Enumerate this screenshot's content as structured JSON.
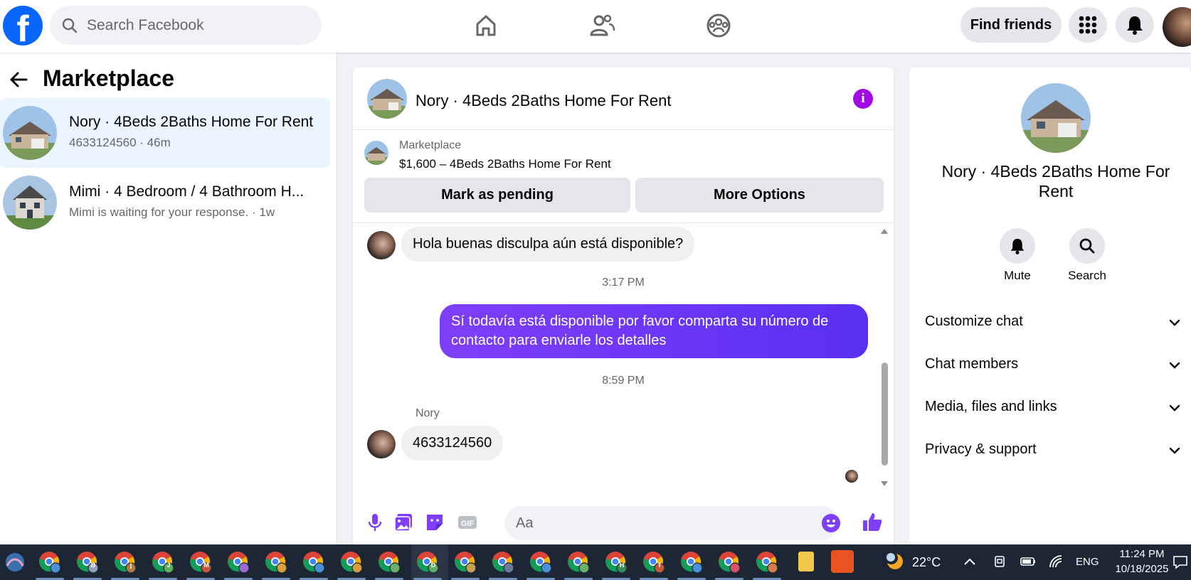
{
  "header": {
    "search_placeholder": "Search Facebook",
    "find_friends": "Find friends",
    "brand_color": "#0866ff"
  },
  "sidebar": {
    "title": "Marketplace",
    "conversations": [
      {
        "name": "Nory · 4Beds 2Baths Home For Rent",
        "sub": "4633124560 · 46m",
        "active": true
      },
      {
        "name": "Mimi · 4 Bedroom / 4 Bathroom H...",
        "sub": "Mimi is waiting for your response. · 1w",
        "active": false
      }
    ]
  },
  "chat": {
    "title": "Nory · 4Beds 2Baths Home For Rent",
    "listing_label": "Marketplace",
    "listing_price": "$1,600 – 4Beds 2Baths Home For Rent",
    "mark_pending": "Mark as pending",
    "more_options": "More Options",
    "messages": [
      {
        "from": "them",
        "text": "Hola buenas disculpa aún está disponible?"
      },
      {
        "timestamp": "3:17 PM"
      },
      {
        "from": "me",
        "text": "Sí todavía está disponible por favor comparta su número de contacto para enviarle los detalles"
      },
      {
        "timestamp": "8:59 PM"
      },
      {
        "from": "them",
        "sender": "Nory",
        "text": "4633124560"
      }
    ],
    "input_placeholder": "Aa",
    "accent_color": "#7f3ff8"
  },
  "details": {
    "title": "Nory · 4Beds 2Baths Home For Rent",
    "actions": [
      "Mute",
      "Search"
    ],
    "sections": [
      "Customize chat",
      "Chat members",
      "Media, files and links",
      "Privacy & support"
    ]
  },
  "taskbar": {
    "apps": [
      "",
      "B",
      "j",
      "J",
      "M",
      "",
      "",
      "",
      "",
      "",
      "D",
      "",
      "",
      "",
      "",
      "H",
      "T",
      "",
      "",
      ""
    ],
    "weather": "22°C",
    "language": "ENG",
    "time": "11:24 PM",
    "date": "10/18/2025"
  }
}
